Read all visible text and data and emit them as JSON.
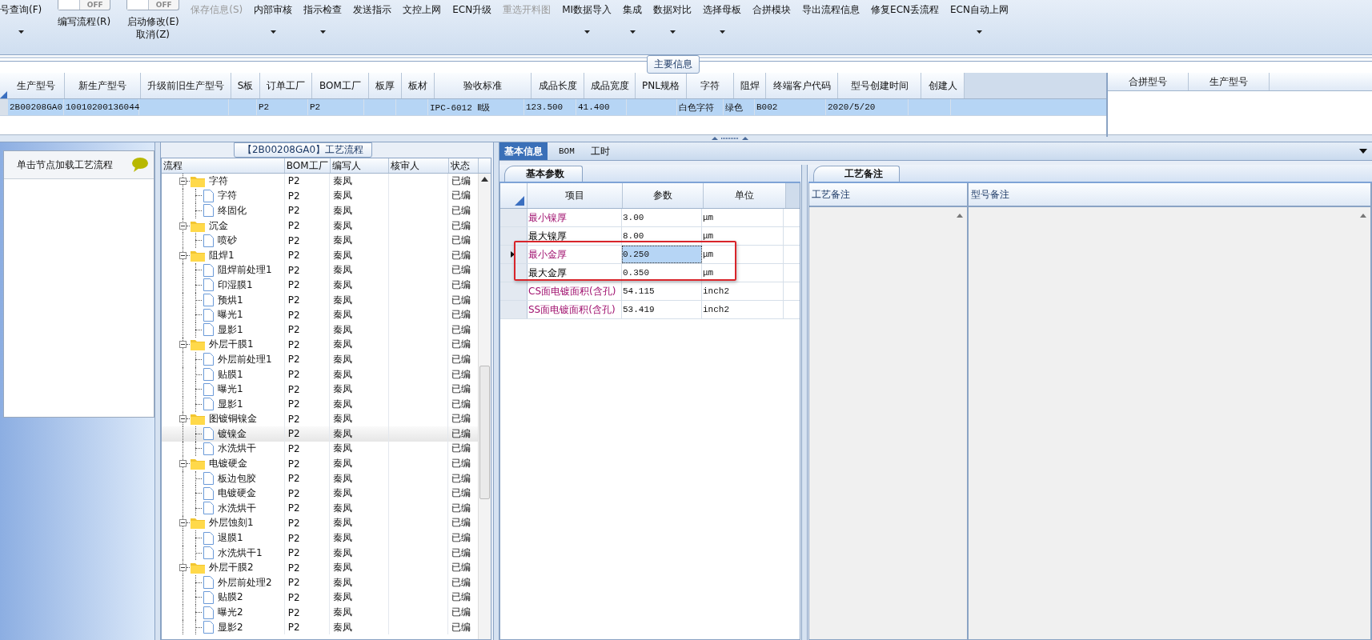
{
  "toolbar": {
    "items": [
      {
        "kind": "button",
        "label": "号查询(F)",
        "disabled": false,
        "dropdown": true
      },
      {
        "kind": "toggle",
        "toggle_text": "OFF",
        "on": false,
        "label": "编写流程(R)"
      },
      {
        "kind": "toggle",
        "toggle_text": "OFF",
        "on": false,
        "label": "启动修改(E)",
        "sub_label": "取消(Z)"
      },
      {
        "kind": "button",
        "label": "保存信息(S)",
        "disabled": true,
        "dropdown": false
      },
      {
        "kind": "button",
        "label": "内部审核",
        "disabled": false,
        "dropdown": true
      },
      {
        "kind": "button",
        "label": "指示检查",
        "disabled": false,
        "dropdown": true
      },
      {
        "kind": "button",
        "label": "发送指示",
        "disabled": false,
        "dropdown": false
      },
      {
        "kind": "button",
        "label": "文控上网",
        "disabled": false,
        "dropdown": false
      },
      {
        "kind": "button",
        "label": "ECN升级",
        "disabled": false,
        "dropdown": false
      },
      {
        "kind": "button",
        "label": "重选开料图",
        "disabled": true,
        "dropdown": false
      },
      {
        "kind": "button",
        "label": "MI数据导入",
        "disabled": false,
        "dropdown": true
      },
      {
        "kind": "button",
        "label": "集成",
        "disabled": false,
        "dropdown": true
      },
      {
        "kind": "button",
        "label": "数据对比",
        "disabled": false,
        "dropdown": true
      },
      {
        "kind": "button",
        "label": "选择母板",
        "disabled": false,
        "dropdown": true
      },
      {
        "kind": "button",
        "label": "合拼模块",
        "disabled": false,
        "dropdown": false
      },
      {
        "kind": "button",
        "label": "导出流程信息",
        "disabled": false,
        "dropdown": false
      },
      {
        "kind": "button",
        "label": "修复ECN丢流程",
        "disabled": false,
        "dropdown": false
      },
      {
        "kind": "button",
        "label": "ECN自动上网",
        "disabled": false,
        "dropdown": true
      }
    ]
  },
  "main_info": {
    "title": "主要信息",
    "columns": [
      "生产型号",
      "新生产型号",
      "升级前旧生产型号",
      "S板",
      "订单工厂",
      "BOM工厂",
      "板厚",
      "板材",
      "验收标准",
      "成品长度",
      "成品宽度",
      "PNL规格",
      "字符",
      "阻焊",
      "终端客户代码",
      "型号创建时间",
      "创建人"
    ],
    "rows": [
      {
        "selected": true,
        "cells": [
          "2B00208GA0",
          "10010200136044",
          null,
          null,
          "P2",
          "P2",
          null,
          null,
          "IPC-6012 Ⅱ级",
          "123.500",
          "41.400",
          null,
          "白色字符",
          "绿色",
          "B002",
          "2020/5/20",
          null
        ]
      }
    ],
    "side_columns": [
      "合拼型号",
      "生产型号"
    ]
  },
  "left_panel": {
    "hint": "单击节点加载工艺流程"
  },
  "process_tree": {
    "title": "【2B00208GA0】工艺流程",
    "columns": [
      "流程",
      "BOM工厂",
      "编写人",
      "核审人",
      "状态"
    ],
    "nodes": [
      {
        "name": "字符",
        "bom_factory": "P2",
        "writer": "秦凤",
        "status": "已编",
        "expanded": true,
        "selected": false,
        "children": [
          {
            "name": "字符",
            "bom_factory": "P2",
            "writer": "秦凤",
            "status": "已编",
            "selected": false
          },
          {
            "name": "终固化",
            "bom_factory": "P2",
            "writer": "秦凤",
            "status": "已编",
            "selected": false
          }
        ]
      },
      {
        "name": "沉金",
        "bom_factory": "P2",
        "writer": "秦凤",
        "status": "已编",
        "expanded": true,
        "selected": false,
        "children": [
          {
            "name": "喷砂",
            "bom_factory": "P2",
            "writer": "秦凤",
            "status": "已编",
            "selected": false
          }
        ]
      },
      {
        "name": "阻焊1",
        "bom_factory": "P2",
        "writer": "秦凤",
        "status": "已编",
        "expanded": true,
        "selected": false,
        "children": [
          {
            "name": "阻焊前处理1",
            "bom_factory": "P2",
            "writer": "秦凤",
            "status": "已编",
            "selected": false
          },
          {
            "name": "印湿膜1",
            "bom_factory": "P2",
            "writer": "秦凤",
            "status": "已编",
            "selected": false
          },
          {
            "name": "预烘1",
            "bom_factory": "P2",
            "writer": "秦凤",
            "status": "已编",
            "selected": false
          },
          {
            "name": "曝光1",
            "bom_factory": "P2",
            "writer": "秦凤",
            "status": "已编",
            "selected": false
          },
          {
            "name": "显影1",
            "bom_factory": "P2",
            "writer": "秦凤",
            "status": "已编",
            "selected": false
          }
        ]
      },
      {
        "name": "外层干膜1",
        "bom_factory": "P2",
        "writer": "秦凤",
        "status": "已编",
        "expanded": true,
        "selected": false,
        "children": [
          {
            "name": "外层前处理1",
            "bom_factory": "P2",
            "writer": "秦凤",
            "status": "已编",
            "selected": false
          },
          {
            "name": "贴膜1",
            "bom_factory": "P2",
            "writer": "秦凤",
            "status": "已编",
            "selected": false
          },
          {
            "name": "曝光1",
            "bom_factory": "P2",
            "writer": "秦凤",
            "status": "已编",
            "selected": false
          },
          {
            "name": "显影1",
            "bom_factory": "P2",
            "writer": "秦凤",
            "status": "已编",
            "selected": false
          }
        ]
      },
      {
        "name": "图镀铜镍金",
        "bom_factory": "P2",
        "writer": "秦凤",
        "status": "已编",
        "expanded": true,
        "selected": false,
        "children": [
          {
            "name": "镀镍金",
            "bom_factory": "P2",
            "writer": "秦凤",
            "status": "已编",
            "selected": true
          },
          {
            "name": "水洗烘干",
            "bom_factory": "P2",
            "writer": "秦凤",
            "status": "已编",
            "selected": false
          }
        ]
      },
      {
        "name": "电镀硬金",
        "bom_factory": "P2",
        "writer": "秦凤",
        "status": "已编",
        "expanded": true,
        "selected": false,
        "children": [
          {
            "name": "板边包胶",
            "bom_factory": "P2",
            "writer": "秦凤",
            "status": "已编",
            "selected": false
          },
          {
            "name": "电镀硬金",
            "bom_factory": "P2",
            "writer": "秦凤",
            "status": "已编",
            "selected": false
          },
          {
            "name": "水洗烘干",
            "bom_factory": "P2",
            "writer": "秦凤",
            "status": "已编",
            "selected": false
          }
        ]
      },
      {
        "name": "外层蚀刻1",
        "bom_factory": "P2",
        "writer": "秦凤",
        "status": "已编",
        "expanded": true,
        "selected": false,
        "children": [
          {
            "name": "退膜1",
            "bom_factory": "P2",
            "writer": "秦凤",
            "status": "已编",
            "selected": false
          },
          {
            "name": "水洗烘干1",
            "bom_factory": "P2",
            "writer": "秦凤",
            "status": "已编",
            "selected": false
          }
        ]
      },
      {
        "name": "外层干膜2",
        "bom_factory": "P2",
        "writer": "秦凤",
        "status": "已编",
        "expanded": true,
        "selected": false,
        "children": [
          {
            "name": "外层前处理2",
            "bom_factory": "P2",
            "writer": "秦凤",
            "status": "已编",
            "selected": false
          },
          {
            "name": "贴膜2",
            "bom_factory": "P2",
            "writer": "秦凤",
            "status": "已编",
            "selected": false
          },
          {
            "name": "曝光2",
            "bom_factory": "P2",
            "writer": "秦凤",
            "status": "已编",
            "selected": false
          },
          {
            "name": "显影2",
            "bom_factory": "P2",
            "writer": "秦凤",
            "status": "已编",
            "selected": false
          }
        ]
      }
    ]
  },
  "detail_tabs": [
    {
      "label": "基本信息",
      "selected": true
    },
    {
      "label": "BOM",
      "selected": false
    },
    {
      "label": "工时",
      "selected": false
    }
  ],
  "basic_params": {
    "title": "基本参数",
    "columns": [
      "项目",
      "参数",
      "单位"
    ],
    "rows": [
      {
        "item": "最小镍厚",
        "value": "3.00",
        "unit": "μm",
        "emphasized": true,
        "current": false,
        "highlighted": false
      },
      {
        "item": "最大镍厚",
        "value": "8.00",
        "unit": "μm",
        "emphasized": false,
        "current": false,
        "highlighted": false
      },
      {
        "item": "最小金厚",
        "value": "0.250",
        "unit": "μm",
        "emphasized": true,
        "current": true,
        "highlighted": true
      },
      {
        "item": "最大金厚",
        "value": "0.350",
        "unit": "μm",
        "emphasized": false,
        "current": false,
        "highlighted": true
      },
      {
        "item": "CS面电镀面积(含孔)",
        "value": "54.115",
        "unit": "inch2",
        "emphasized": true,
        "current": false,
        "highlighted": false
      },
      {
        "item": "SS面电镀面积(含孔)",
        "value": "53.419",
        "unit": "inch2",
        "emphasized": true,
        "current": false,
        "highlighted": false
      }
    ]
  },
  "remarks": {
    "title": "工艺备注",
    "columns": [
      "工艺备注",
      "型号备注"
    ]
  }
}
